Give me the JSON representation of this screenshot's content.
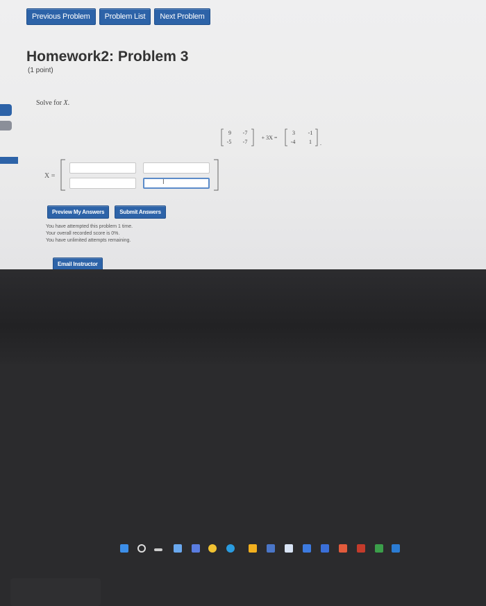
{
  "nav": {
    "previous": "Previous Problem",
    "list": "Problem List",
    "next": "Next Problem"
  },
  "problem": {
    "title": "Homework2: Problem 3",
    "points": "(1 point)",
    "prompt_prefix": "Solve for",
    "prompt_var": "X",
    "prompt_end": ".",
    "equation": {
      "A": [
        [
          "9",
          "-7"
        ],
        [
          "-5",
          "-7"
        ]
      ],
      "coef": "+ 3X =",
      "B": [
        [
          "3",
          "-1"
        ],
        [
          "-4",
          "1"
        ]
      ],
      "end": "."
    },
    "answer_label": "X ="
  },
  "actions": {
    "preview": "Preview My Answers",
    "submit": "Submit Answers"
  },
  "status": [
    "You have attempted this problem 1 time.",
    "Your overall recorded score is 0%.",
    "You have unlimited attempts remaining."
  ],
  "email": "Email Instructor",
  "colors": {
    "accent": "#2d63a8"
  }
}
